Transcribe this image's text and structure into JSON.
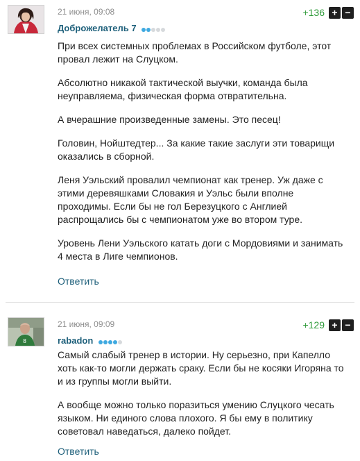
{
  "comments": [
    {
      "date": "21 июня, 09:08",
      "author": "Доброжелатель 7",
      "rating_level": 2,
      "rating_max": 5,
      "score": "+136",
      "paragraphs": [
        "При всех системных проблемах в Российском футболе, этот провал лежит на Слуцком.",
        "Абсолютно никакой тактической выучки, команда была неуправляема, физическая форма отвратительна.",
        "А вчерашние произведенные замены. Это песец!",
        "Головин, Нойштедтер... За какие такие заслуги эти товарищи оказались в сборной.",
        "Леня Уэльский провалил чемпионат как тренер. Уж даже с этими деревяшками Словакия и Уэльс были вполне проходимы. Если бы не гол Березуцкого с Англией распрощались бы с чемпионатом уже во втором туре.",
        "Уровень Лени Уэльского катать доги с Мордовиями и занимать 4 места в Лиге чемпионов."
      ],
      "reply_label": "Ответить"
    },
    {
      "date": "21 июня, 09:09",
      "author": "rabadon",
      "rating_level": 4,
      "rating_max": 5,
      "score": "+129",
      "paragraphs": [
        "Самый слабый тренер в истории. Ну серьезно, при Капелло хоть как-то могли держать сраку. Если бы не косяки Игоряна то и из группы могли выйти.",
        "А вообще можно только поразиться умению Слуцкого чесать языком. Ни единого слова плохого. Я бы ему в политику советовал наведаться, далеко пойдет."
      ],
      "reply_label": "Ответить"
    }
  ],
  "vote_up_symbol": "+",
  "vote_down_symbol": "−",
  "colors": {
    "author": "#1d5f7a",
    "score": "#2f9b3a",
    "rating_on": "#3fa9e0",
    "rating_off": "#d6d9dc"
  }
}
